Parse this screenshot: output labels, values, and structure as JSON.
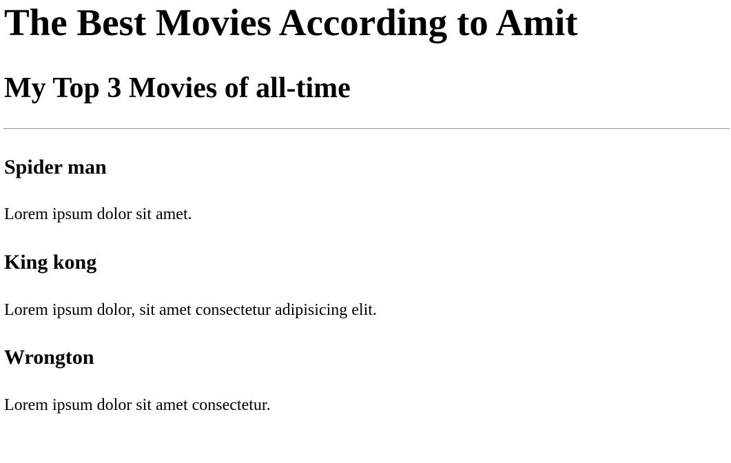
{
  "page": {
    "heading": "The Best Movies According to Amit",
    "subheading": "My Top 3 Movies of all-time"
  },
  "movies": [
    {
      "title": "Spider man",
      "description": "Lorem ipsum dolor sit amet."
    },
    {
      "title": "King kong",
      "description": "Lorem ipsum dolor, sit amet consectetur adipisicing elit."
    },
    {
      "title": "Wrongton",
      "description": "Lorem ipsum dolor sit amet consectetur."
    }
  ]
}
